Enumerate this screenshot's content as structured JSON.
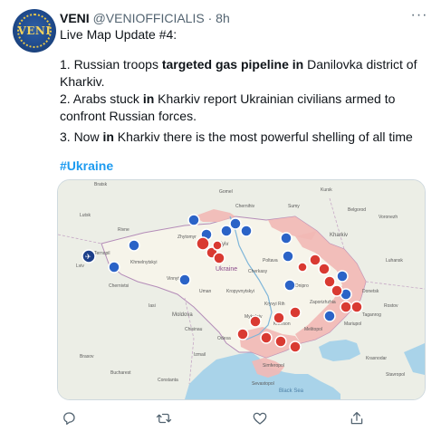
{
  "tweet": {
    "author_name": "VENI",
    "handle": "@VENIOFFICIALIS",
    "separator": "·",
    "time": "8h",
    "more_label": "···",
    "avatar_text": "VENI",
    "line1": "Live Map Update #4:",
    "item1": {
      "a": "1. Russian troops ",
      "b": "targeted gas pipeline in",
      "c": " Danilovka district of Kharkiv."
    },
    "item2": {
      "a": "2. Arabs stuck ",
      "b": "in",
      "c": " Kharkiv report Ukrainian civilians armed to confront Russian forces."
    },
    "item3": {
      "a": "3. Now ",
      "b": "in",
      "c": " Kharkiv there is the most powerful shelling of all time"
    },
    "hashtag": "#Ukraine"
  },
  "map": {
    "sea_label": "Black Sea",
    "labels": [
      "Kyiv",
      "Cherkasy",
      "Kharkiv",
      "Kropyvnytskyi",
      "Kryvyi Rih",
      "Kherson",
      "Mykolaiv",
      "Odesa",
      "Chisinau",
      "Dnipro",
      "Poltava",
      "Sumy",
      "Chernihiv",
      "Zhytomyr",
      "Vinnytsia",
      "Lviv",
      "Rivne",
      "Luhansk",
      "Donetsk",
      "Mariupol",
      "Zaporizhzhia",
      "Sevastopol",
      "Melitopol",
      "Ukraine",
      "Bratsk",
      "Gomel",
      "Belgorod",
      "Voronezh",
      "Rostov",
      "Taganrog",
      "Krasnodar",
      "Stavropol",
      "Simferopol",
      "Chernivtsi",
      "Khmelnytskyi",
      "Ternopil",
      "Uman",
      "Izmail",
      "Brasov",
      "Bucharest",
      "Constanta",
      "Kursk",
      "Lutsk",
      "Moldova",
      "Iasi"
    ]
  },
  "actions": {
    "reply_icon": "reply-icon",
    "retweet_icon": "retweet-icon",
    "like_icon": "like-icon",
    "share_icon": "share-icon"
  },
  "colors": {
    "link": "#1d9bf0",
    "secondary_text": "#536471",
    "occupied_area": "#f2b8b5",
    "marker_red": "#d93a32",
    "marker_blue": "#2b63c7"
  }
}
